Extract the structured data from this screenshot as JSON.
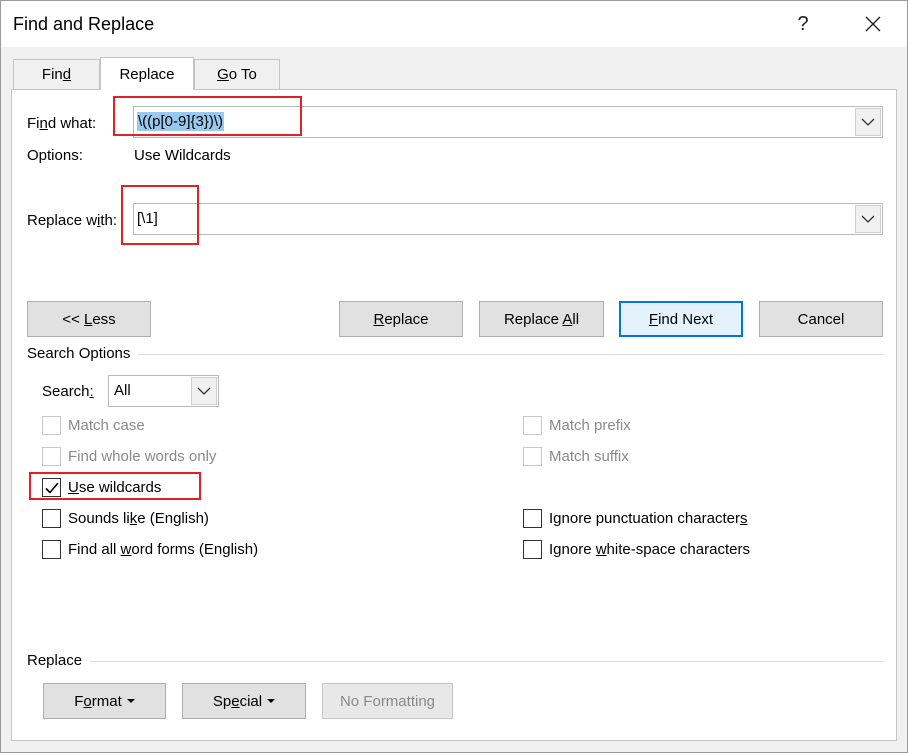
{
  "window": {
    "title": "Find and Replace",
    "help": "?"
  },
  "tabs": [
    {
      "pre": "Fin",
      "key": "d",
      "post": "",
      "active": false
    },
    {
      "pre": "Replace",
      "key": "",
      "post": "",
      "active": true
    },
    {
      "pre": "",
      "key": "G",
      "post": "o To",
      "active": false
    }
  ],
  "find": {
    "label_pre": "Fi",
    "label_key": "n",
    "label_post": "d what:",
    "value": "\\((p[0-9]{3})\\)"
  },
  "options": {
    "label": "Options:",
    "value": "Use Wildcards"
  },
  "replace": {
    "label_pre": "Replace w",
    "label_key": "i",
    "label_post": "th:",
    "value": "[\\1]"
  },
  "buttons": {
    "less": {
      "pre": "<< ",
      "key": "L",
      "post": "ess"
    },
    "replace": {
      "pre": "",
      "key": "R",
      "post": "eplace"
    },
    "replace_all": {
      "pre": "Replace ",
      "key": "A",
      "post": "ll"
    },
    "find_next": {
      "pre": "",
      "key": "F",
      "post": "ind Next"
    },
    "cancel": {
      "pre": "Cancel",
      "key": "",
      "post": ""
    }
  },
  "search_options": {
    "heading": "Search Options",
    "search_label_pre": "Search",
    "search_label_key": ":",
    "search_label_post": "",
    "search_value": "All",
    "left": [
      {
        "pre": "Matc",
        "key": "h",
        "post": " case",
        "checked": false,
        "disabled": true
      },
      {
        "pre": "Find wh",
        "key": "o",
        "post": "le words only",
        "checked": false,
        "disabled": true
      },
      {
        "pre": "",
        "key": "U",
        "post": "se wildcards",
        "checked": true,
        "disabled": false
      },
      {
        "pre": "Sounds li",
        "key": "k",
        "post": "e (English)",
        "checked": false,
        "disabled": false
      },
      {
        "pre": "Find all ",
        "key": "w",
        "post": "ord forms (English)",
        "checked": false,
        "disabled": false
      }
    ],
    "right": [
      {
        "pre": "Match prefi",
        "key": "x",
        "post": "",
        "checked": false,
        "disabled": true
      },
      {
        "pre": "Match suffi",
        "key": "x",
        "post": "",
        "checked": false,
        "disabled": true
      },
      {
        "pre": "Ignore punctuation character",
        "key": "s",
        "post": "",
        "checked": false,
        "disabled": false
      },
      {
        "pre": "Ignore ",
        "key": "w",
        "post": "hite-space characters",
        "checked": false,
        "disabled": false
      }
    ]
  },
  "replace_section": {
    "heading": "Replace",
    "format": {
      "pre": "F",
      "key": "o",
      "post": "rmat"
    },
    "special": {
      "pre": "Sp",
      "key": "e",
      "post": "cial"
    },
    "no_formatting": "No Formatting"
  }
}
